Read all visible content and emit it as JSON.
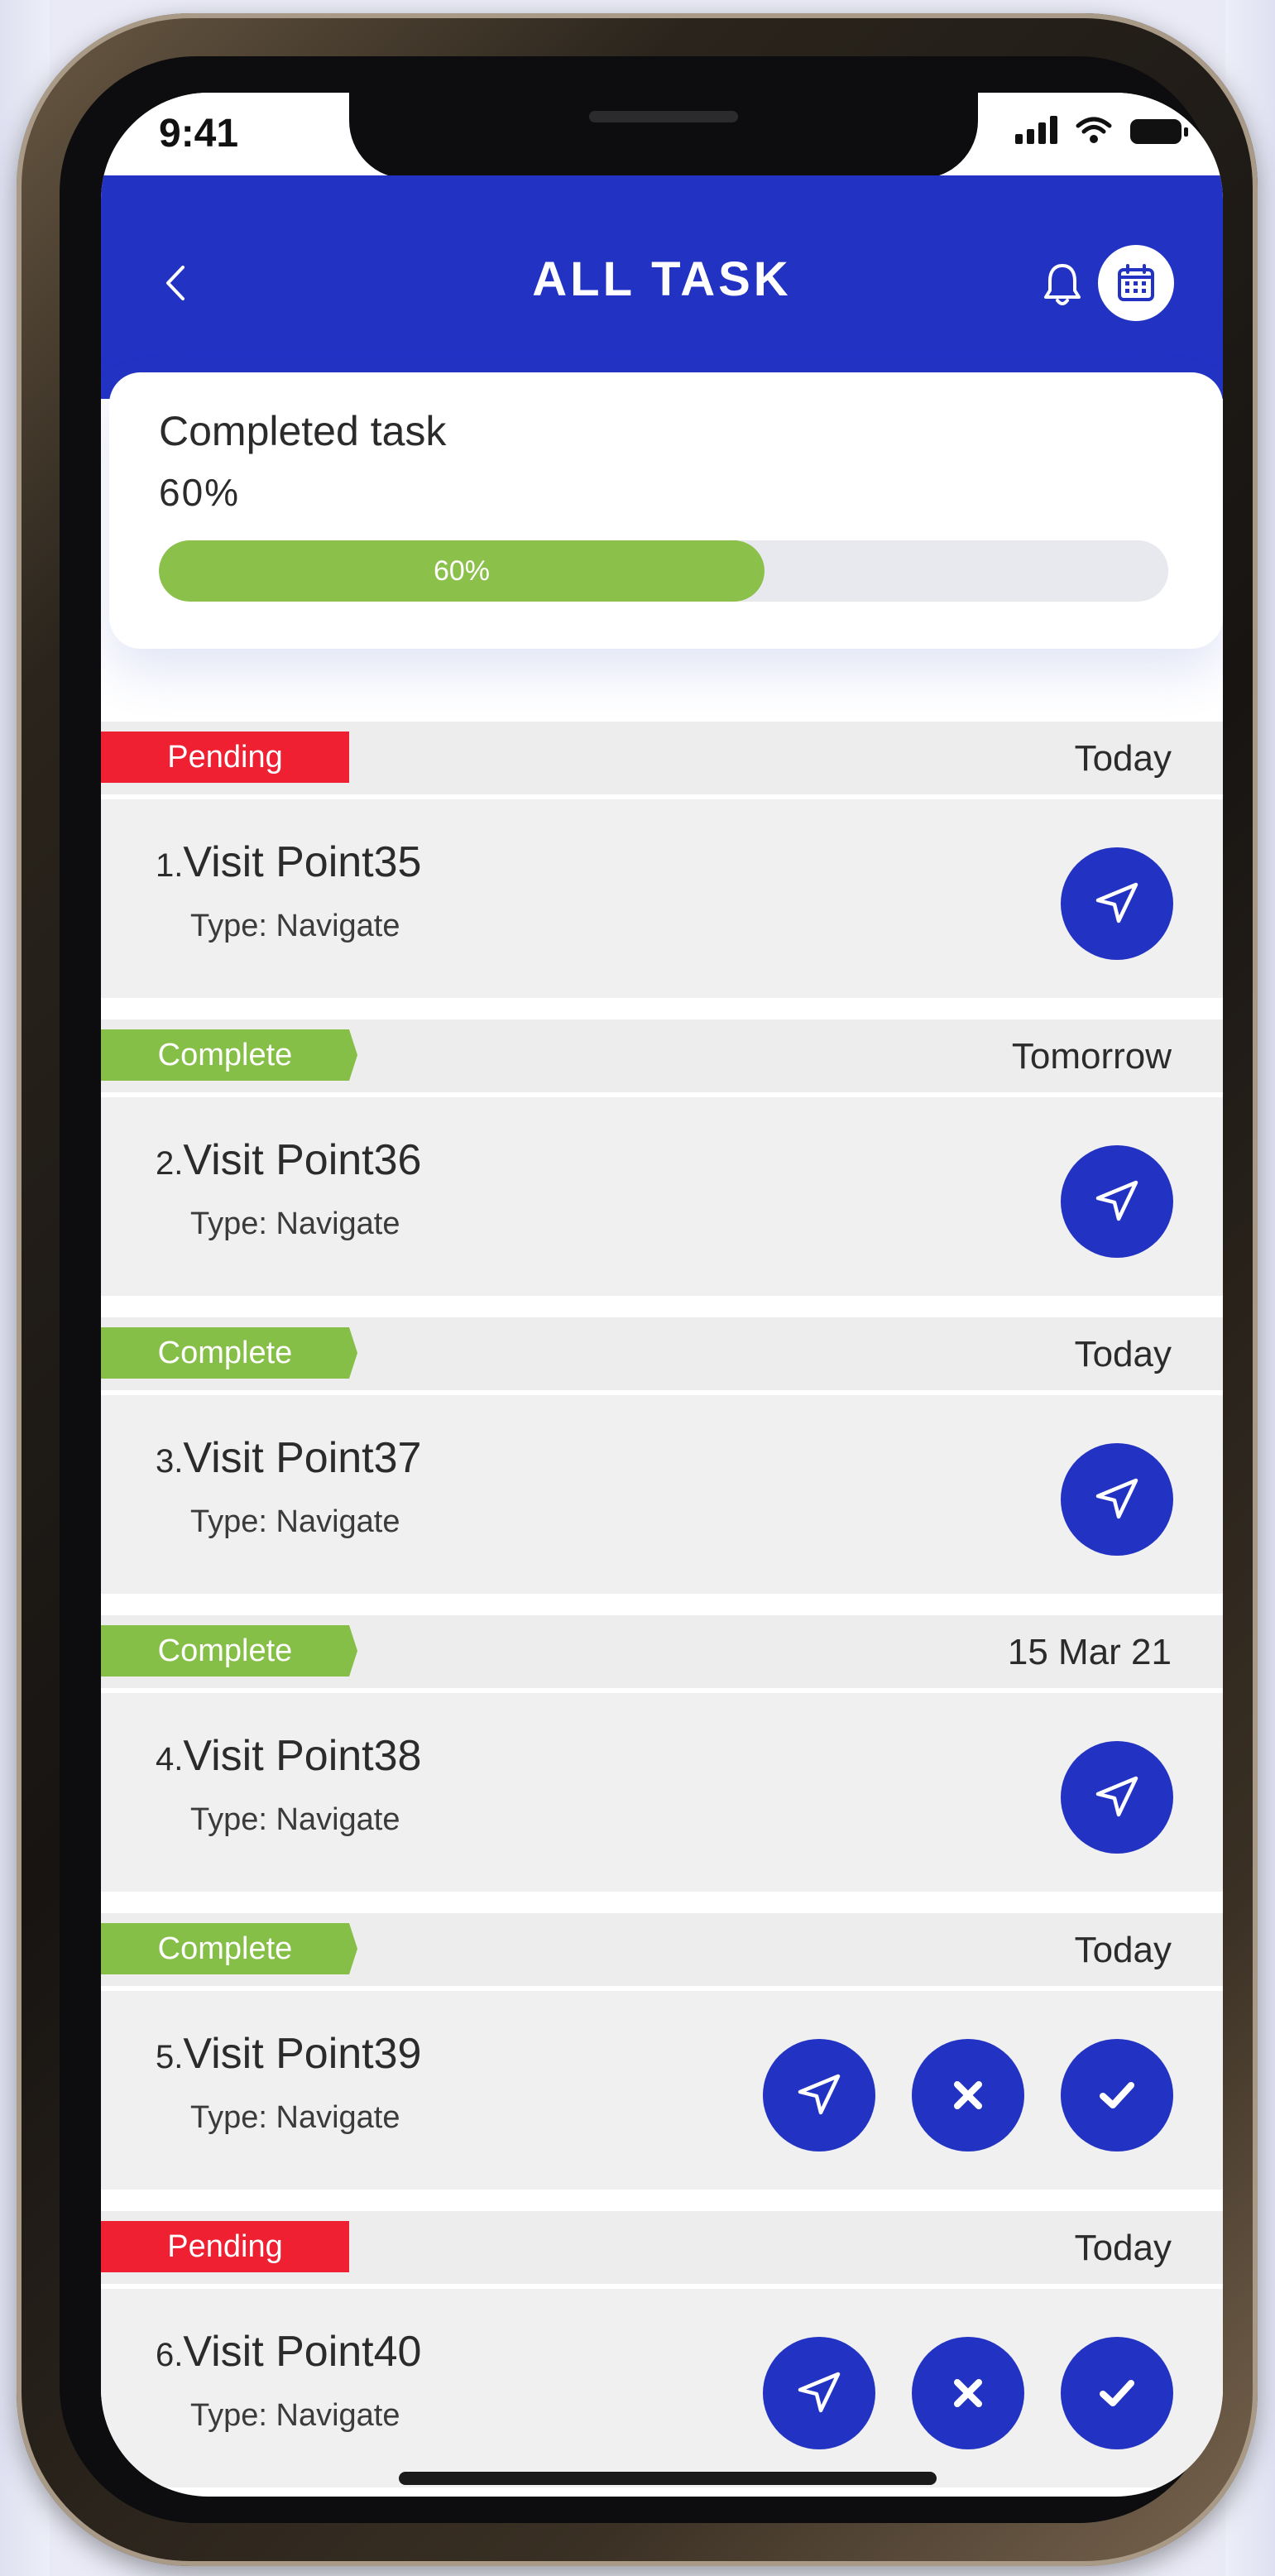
{
  "status_bar": {
    "time": "9:41"
  },
  "header": {
    "title": "ALL TASK",
    "back_icon": "chevron-left-icon",
    "bell_icon": "bell-icon",
    "calendar_icon": "calendar-icon"
  },
  "progress": {
    "title": "Completed task",
    "percent_text": "60%",
    "bar_label": "60%",
    "value": 0.6
  },
  "colors": {
    "primary": "#2233c4",
    "pending": "#ee2031",
    "complete": "#86bf47"
  },
  "tasks": [
    {
      "number": "1.",
      "title": "Visit Point35",
      "type": "Type:  Navigate",
      "status": "Pending",
      "date": "Today",
      "actions": [
        "navigate"
      ]
    },
    {
      "number": "2.",
      "title": "Visit Point36",
      "type": "Type:  Navigate",
      "status": "Complete",
      "date": "Tomorrow",
      "actions": [
        "navigate"
      ]
    },
    {
      "number": "3.",
      "title": "Visit Point37",
      "type": "Type:  Navigate",
      "status": "Complete",
      "date": "Today",
      "actions": [
        "navigate"
      ]
    },
    {
      "number": "4.",
      "title": "Visit Point38",
      "type": "Type:  Navigate",
      "status": "Complete",
      "date": "15 Mar 21",
      "actions": [
        "navigate"
      ]
    },
    {
      "number": "5.",
      "title": "Visit Point39",
      "type": "Type:  Navigate",
      "status": "Complete",
      "date": "Today",
      "actions": [
        "navigate",
        "reject",
        "accept"
      ]
    },
    {
      "number": "6.",
      "title": "Visit Point40",
      "type": "Type:  Navigate",
      "status": "Pending",
      "date": "Today",
      "actions": [
        "navigate",
        "reject",
        "accept"
      ]
    }
  ]
}
